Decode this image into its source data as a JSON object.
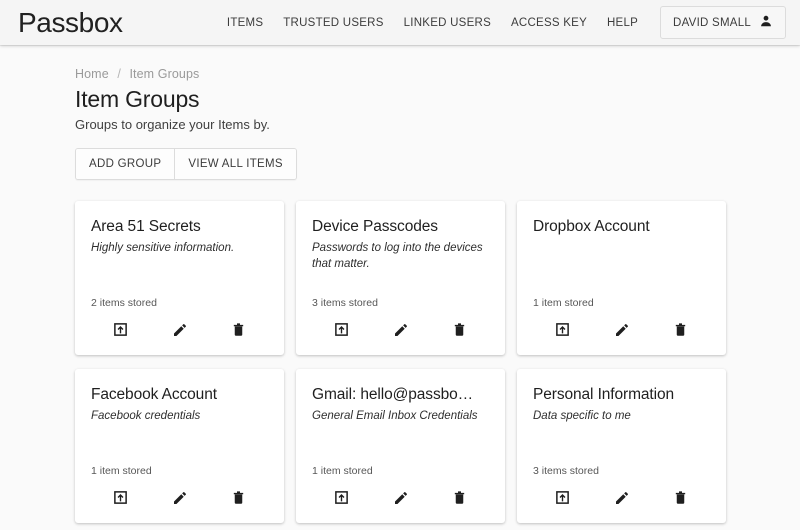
{
  "navbar": {
    "brand": "Passbox",
    "links": [
      {
        "label": "ITEMS",
        "name": "nav-link-items"
      },
      {
        "label": "TRUSTED USERS",
        "name": "nav-link-trusted-users"
      },
      {
        "label": "LINKED USERS",
        "name": "nav-link-linked-users"
      },
      {
        "label": "ACCESS KEY",
        "name": "nav-link-access-key"
      },
      {
        "label": "HELP",
        "name": "nav-link-help"
      }
    ],
    "user": {
      "label": "DAVID SMALL",
      "icon": "person-icon"
    }
  },
  "breadcrumb": {
    "home": "Home",
    "separator": "/",
    "current": "Item Groups"
  },
  "header": {
    "title": "Item Groups",
    "subtitle": "Groups to organize your Items by."
  },
  "toolbar": {
    "add_group_label": "ADD GROUP",
    "view_all_items_label": "VIEW ALL ITEMS"
  },
  "card_actions": {
    "open_icon": "launch-icon",
    "edit_icon": "pencil-icon",
    "delete_icon": "trash-icon"
  },
  "colors": {
    "page_background": "#fafafa",
    "navbar_background": "#f5f5f5",
    "card_background": "#ffffff",
    "text_primary": "#212121",
    "text_muted": "#9a9a9a"
  },
  "groups": [
    {
      "title": "Area 51 Secrets",
      "description": "Highly sensitive information.",
      "count_label": "2 items stored"
    },
    {
      "title": "Device Passcodes",
      "description": "Passwords to log into the devices that matter.",
      "count_label": "3 items stored"
    },
    {
      "title": "Dropbox Account",
      "description": "",
      "count_label": "1 item stored"
    },
    {
      "title": "Facebook Account",
      "description": "Facebook credentials",
      "count_label": "1 item stored"
    },
    {
      "title": "Gmail: hello@passbo…",
      "description": "General Email Inbox Credentials",
      "count_label": "1 item stored"
    },
    {
      "title": "Personal Information",
      "description": "Data specific to me",
      "count_label": "3 items stored"
    }
  ]
}
